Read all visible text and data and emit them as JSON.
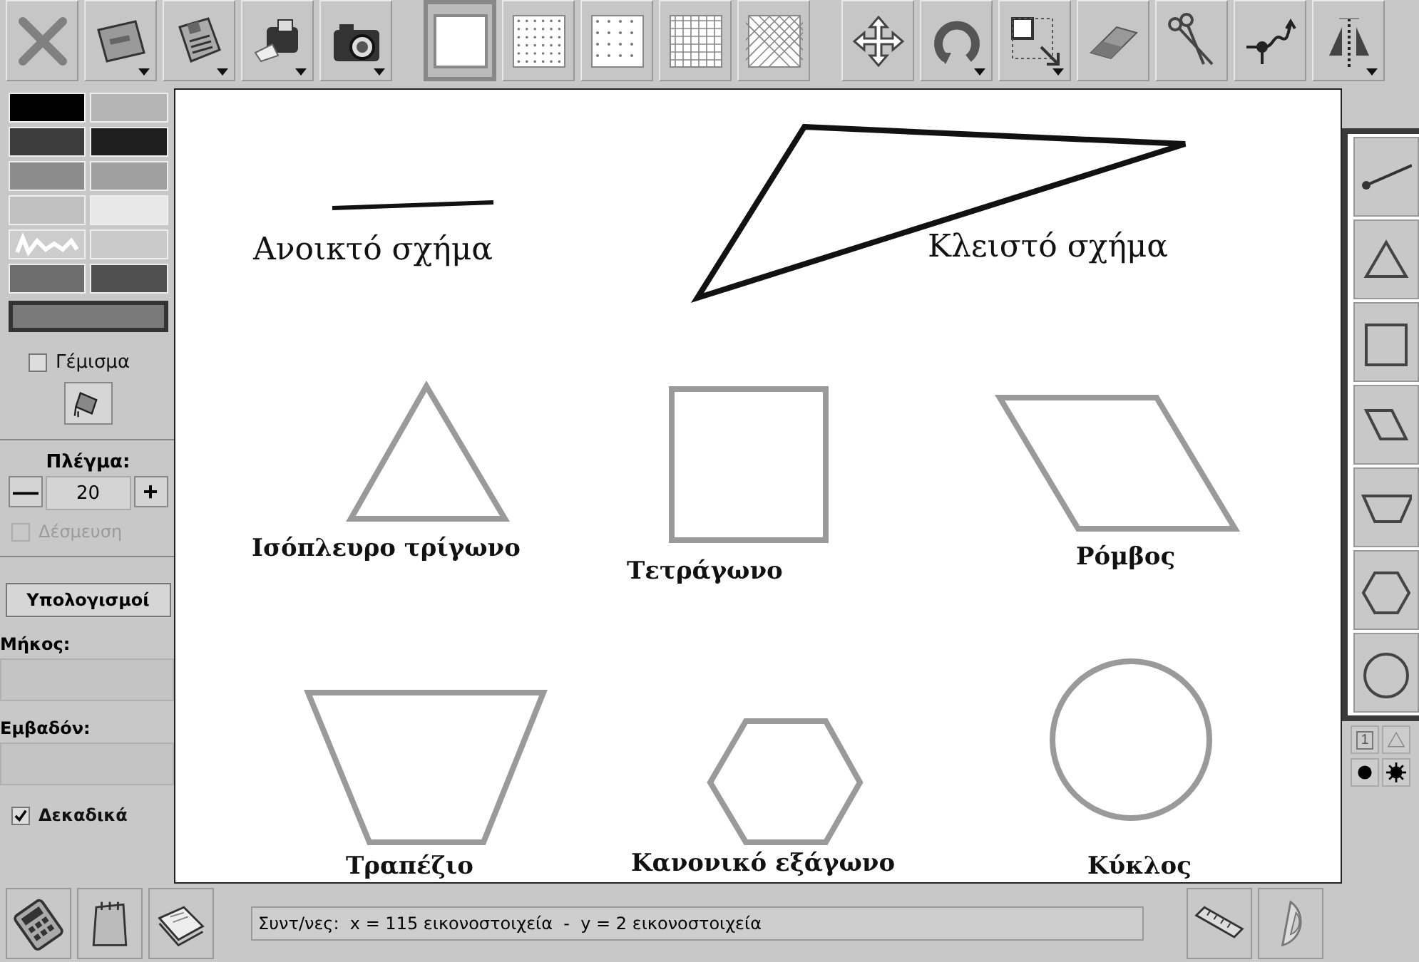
{
  "toolbar": [
    {
      "kind": "close"
    },
    {
      "kind": "folder",
      "dropdown": true
    },
    {
      "kind": "save",
      "dropdown": true
    },
    {
      "kind": "print",
      "dropdown": true
    },
    {
      "kind": "camera",
      "dropdown": true
    },
    {
      "kind": "gap"
    },
    {
      "kind": "grid-blank",
      "selected": true
    },
    {
      "kind": "grid-dots",
      "selected": false
    },
    {
      "kind": "grid-sparse",
      "selected": false
    },
    {
      "kind": "grid-square",
      "selected": false
    },
    {
      "kind": "grid-iso",
      "selected": false
    },
    {
      "kind": "gap"
    },
    {
      "kind": "move"
    },
    {
      "kind": "rotate",
      "dropdown": true
    },
    {
      "kind": "resize",
      "dropdown": true
    },
    {
      "kind": "eraser"
    },
    {
      "kind": "scissors"
    },
    {
      "kind": "point"
    },
    {
      "kind": "mirror",
      "dropdown": true
    }
  ],
  "palette": [
    {
      "color": "#000000"
    },
    {
      "color": "#b4b4b4"
    },
    {
      "color": "#3c3c3c"
    },
    {
      "color": "#1e1e1e"
    },
    {
      "color": "#8c8c8c"
    },
    {
      "color": "#a0a0a0"
    },
    {
      "color": "#c0c0c0"
    },
    {
      "color": "#e8e8e8"
    },
    {
      "kind": "custom"
    },
    {
      "color": "#cacaca"
    },
    {
      "color": "#6e6e6e"
    },
    {
      "color": "#505050"
    }
  ],
  "current": {
    "color": "#7a7a7a"
  },
  "fill": {
    "label": "Γέμισμα",
    "checked": false
  },
  "grid": {
    "label": "Πλέγμα:",
    "minus": "—",
    "value": "20",
    "plus": "+"
  },
  "snap": {
    "label": "Δέσμευση",
    "checked": false,
    "disabled": true
  },
  "calculations_button": "Υπολογισμοί",
  "length": {
    "label": "Μήκος:"
  },
  "area": {
    "label": "Εμβαδόν:"
  },
  "decimals": {
    "label": "Δεκαδικά",
    "checked": true
  },
  "canvas": {
    "shapes": [
      {
        "kind": "segment",
        "color": "#111111"
      },
      {
        "kind": "polygon",
        "color": "#111111"
      },
      {
        "kind": "polygon",
        "color": "#9a9a9a"
      },
      {
        "kind": "rect",
        "color": "#9a9a9a"
      },
      {
        "kind": "polygon",
        "color": "#9a9a9a"
      },
      {
        "kind": "polygon",
        "color": "#9a9a9a"
      },
      {
        "kind": "polygon",
        "color": "#9a9a9a"
      },
      {
        "kind": "circle",
        "color": "#9a9a9a"
      }
    ],
    "labels": [
      "Ανοικτό σχήμα",
      "Κλειστό σχήμα",
      "Ισόπλευρο τρίγωνο",
      "Τετράγωνο",
      "Ρόμβος",
      "Τραπέζιο",
      "Κανονικό εξάγωνο",
      "Κύκλος"
    ]
  },
  "shape_tools": [
    {
      "kind": "segment",
      "selected": false
    },
    {
      "kind": "triangle",
      "selected": false
    },
    {
      "kind": "square",
      "selected": false
    },
    {
      "kind": "parallelogram",
      "selected": false
    },
    {
      "kind": "trapezoid",
      "selected": false
    },
    {
      "kind": "hexagon",
      "selected": false
    },
    {
      "kind": "circle",
      "selected": false
    }
  ],
  "small_tools": {
    "number": "1"
  },
  "status": "Συντ/νες:  x = 115 εικονοστοιχεία  -  y = 2 εικονοστοιχεία"
}
